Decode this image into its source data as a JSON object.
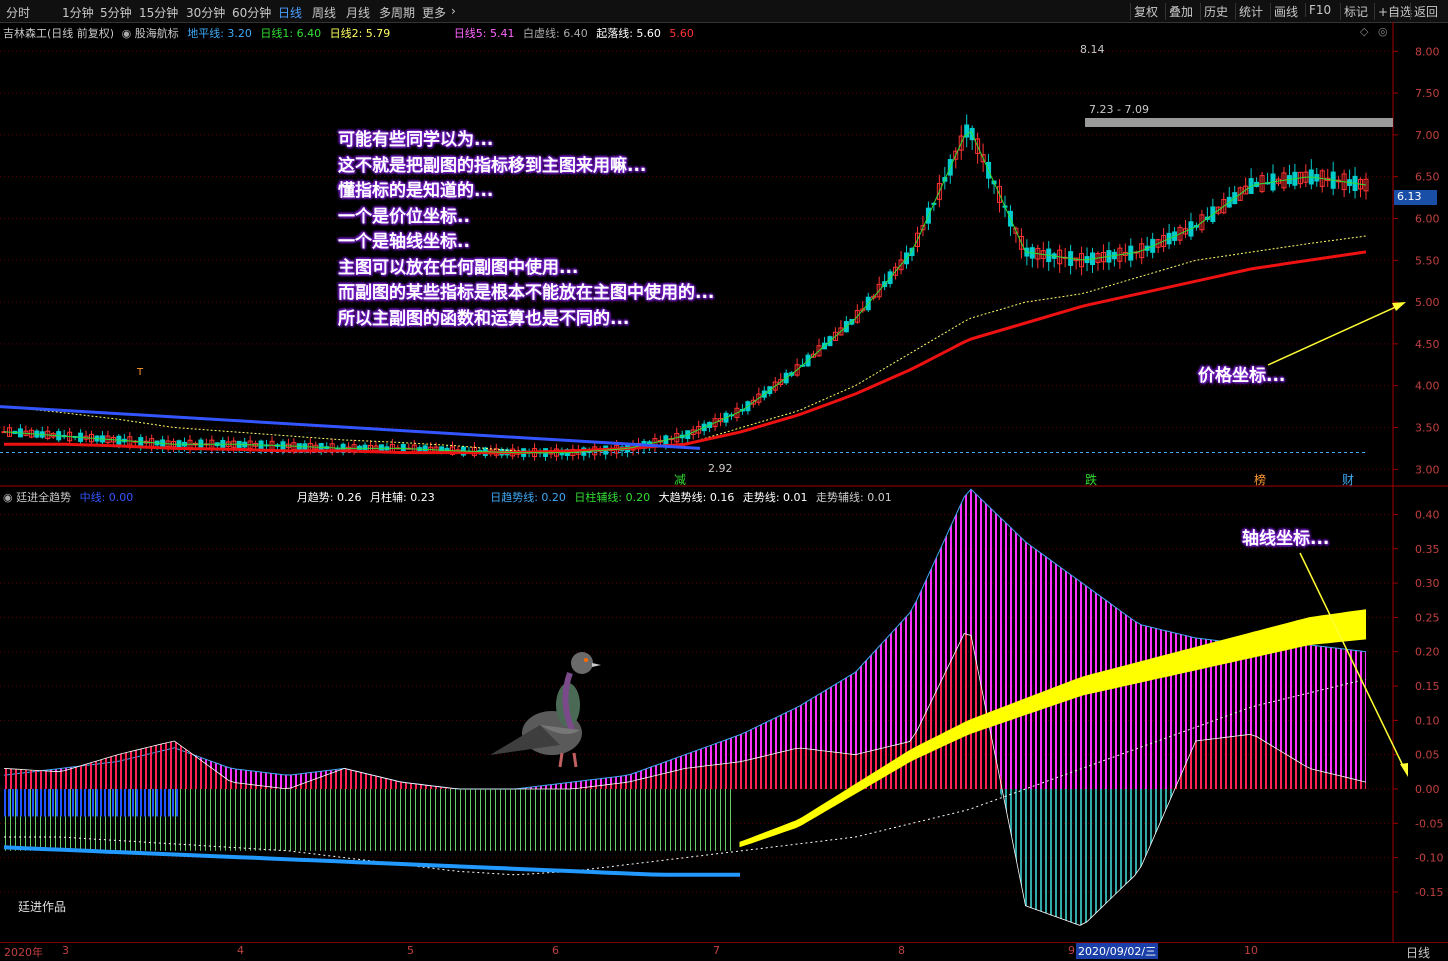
{
  "toolbar": {
    "periods": [
      "分时",
      "1分钟",
      "5分钟",
      "15分钟",
      "30分钟",
      "60分钟",
      "日线",
      "周线",
      "月线",
      "多周期",
      "更多"
    ],
    "active_period": "日线",
    "right_buttons": [
      "复权",
      "叠加",
      "历史",
      "统计",
      "画线",
      "F10",
      "标记",
      "+自选",
      "返回"
    ]
  },
  "main_legend": {
    "stock": "吉林森工(日线 前复权)",
    "indicator": "股海航标",
    "items": [
      {
        "label": "地平线: 3.20",
        "color": "#3fa9f5"
      },
      {
        "label": "日线1: 6.40",
        "color": "#33dd33"
      },
      {
        "label": "日线2: 5.79",
        "color": "#ffff66"
      },
      {
        "label": "日线5: 5.41",
        "color": "#ff66ff"
      },
      {
        "label": "白虚线: 6.40",
        "color": "#aaaaaa"
      },
      {
        "label": "起落线: 5.60",
        "color": "#ffffff"
      },
      {
        "label": "5.60",
        "color": "#ff3333"
      }
    ]
  },
  "sub_legend": {
    "indicator": "廷进全趋势",
    "items": [
      {
        "label": "中线: 0.00",
        "color": "#3355ff"
      },
      {
        "label": "月趋势: 0.26",
        "color": "#ffffff"
      },
      {
        "label": "月柱辅: 0.23",
        "color": "#ffffff"
      },
      {
        "label": "日趋势线: 0.20",
        "color": "#3fa9f5"
      },
      {
        "label": "日柱辅线: 0.20",
        "color": "#33dd33"
      },
      {
        "label": "大趋势线: 0.16",
        "color": "#ffffff"
      },
      {
        "label": "走势线: 0.01",
        "color": "#ffffff"
      },
      {
        "label": "走势辅线: 0.01",
        "color": "#cccccc"
      }
    ]
  },
  "annotations": {
    "main_text": [
      "可能有些同学以为...",
      "这不就是把副图的指标移到主图来用嘛...",
      "懂指标的是知道的...",
      "一个是价位坐标..",
      "一个是轴线坐标..",
      "主图可以放在任何副图中使用...",
      "而副图的某些指标是根本不能放在主图中使用的...",
      "所以主副图的函数和运算也是不同的..."
    ],
    "price_axis_note": "价格坐标...",
    "sub_axis_note": "轴线坐标...",
    "author": "廷进作品"
  },
  "markers": {
    "high_label": "8.14",
    "low_label": "2.92",
    "zone_label": "7.23 - 7.09",
    "current_price": "6.13",
    "signals": [
      {
        "label": "减",
        "color": "#33dd33"
      },
      {
        "label": "跌",
        "color": "#33dd33"
      },
      {
        "label": "榜",
        "color": "#ff9933"
      },
      {
        "label": "财",
        "color": "#3fa9f5"
      }
    ],
    "t_label": "T"
  },
  "x_axis": {
    "labels": [
      "2020年",
      "3",
      "4",
      "5",
      "6",
      "7",
      "8",
      "9",
      "10"
    ],
    "highlight_date": "2020/09/02/三",
    "period": "日线"
  },
  "chart_data": [
    {
      "type": "candlestick",
      "title": "吉林森工(日线 前复权)",
      "y_ticks": [
        3.0,
        3.5,
        4.0,
        4.5,
        5.0,
        5.5,
        6.0,
        6.5,
        7.0,
        7.5,
        8.0
      ],
      "ylim": [
        2.8,
        8.35
      ],
      "ma_lines": {
        "fast": [
          3.45,
          3.4,
          3.35,
          3.3,
          3.3,
          3.28,
          3.25,
          3.25,
          3.22,
          3.2,
          3.2,
          3.25,
          3.4,
          3.7,
          4.2,
          4.8,
          5.6,
          7.1,
          5.6,
          5.5,
          5.6,
          5.9,
          6.4,
          6.5,
          6.4
        ],
        "slow": [
          3.75,
          3.68,
          3.6,
          3.5,
          3.45,
          3.4,
          3.35,
          3.32,
          3.28,
          3.22,
          3.2,
          3.25,
          3.3,
          3.5,
          3.7,
          4.0,
          4.4,
          4.8,
          5.0,
          5.1,
          5.3,
          5.5,
          5.6,
          5.7,
          5.79
        ],
        "red": [
          3.3,
          3.3,
          3.28,
          3.25,
          3.24,
          3.22,
          3.22,
          3.2,
          3.2,
          3.2,
          3.22,
          3.25,
          3.3,
          3.45,
          3.65,
          3.9,
          4.2,
          4.55,
          4.75,
          4.95,
          5.1,
          5.25,
          5.4,
          5.5,
          5.6
        ]
      },
      "high": 8.14,
      "low": 2.92,
      "resistance_zone": [
        7.09,
        7.23
      ],
      "current_price": 6.13,
      "ground_line": 3.2
    },
    {
      "type": "bar",
      "title": "廷进全趋势",
      "y_ticks": [
        -0.15,
        -0.1,
        -0.05,
        0.0,
        0.05,
        0.1,
        0.15,
        0.2,
        0.25,
        0.3,
        0.35,
        0.4
      ],
      "ylim": [
        -0.22,
        0.44
      ],
      "trend_envelope": [
        0.02,
        0.03,
        0.04,
        0.06,
        0.03,
        0.02,
        0.03,
        0.01,
        0.0,
        0.0,
        0.01,
        0.02,
        0.05,
        0.08,
        0.12,
        0.17,
        0.26,
        0.44,
        0.36,
        0.3,
        0.24,
        0.22,
        0.21,
        0.21,
        0.2
      ],
      "red_bars": [
        0.03,
        0.025,
        0.05,
        0.07,
        0.01,
        0.0,
        0.03,
        0.01,
        0.0,
        0.0,
        0.0,
        0.01,
        0.03,
        0.04,
        0.06,
        0.05,
        0.07,
        0.24,
        -0.17,
        -0.2,
        -0.12,
        0.07,
        0.08,
        0.03,
        0.01
      ],
      "yellow_band": [
        -0.12,
        -0.12,
        -0.12,
        -0.13,
        -0.13,
        -0.13,
        -0.13,
        -0.135,
        -0.14,
        -0.135,
        -0.13,
        -0.12,
        -0.105,
        -0.08,
        -0.05,
        0.0,
        0.05,
        0.09,
        0.12,
        0.15,
        0.17,
        0.19,
        0.21,
        0.23,
        0.24
      ],
      "blue_line": [
        -0.085,
        -0.09,
        -0.095,
        -0.1,
        -0.105,
        -0.11,
        -0.115,
        -0.12,
        -0.125,
        -0.125
      ],
      "white_dash": [
        -0.07,
        -0.07,
        -0.075,
        -0.08,
        -0.085,
        -0.09,
        -0.1,
        -0.11,
        -0.12,
        -0.125,
        -0.12,
        -0.11,
        -0.1,
        -0.09,
        -0.08,
        -0.07,
        -0.05,
        -0.03,
        0.0,
        0.03,
        0.06,
        0.09,
        0.12,
        0.14,
        0.16
      ]
    }
  ]
}
